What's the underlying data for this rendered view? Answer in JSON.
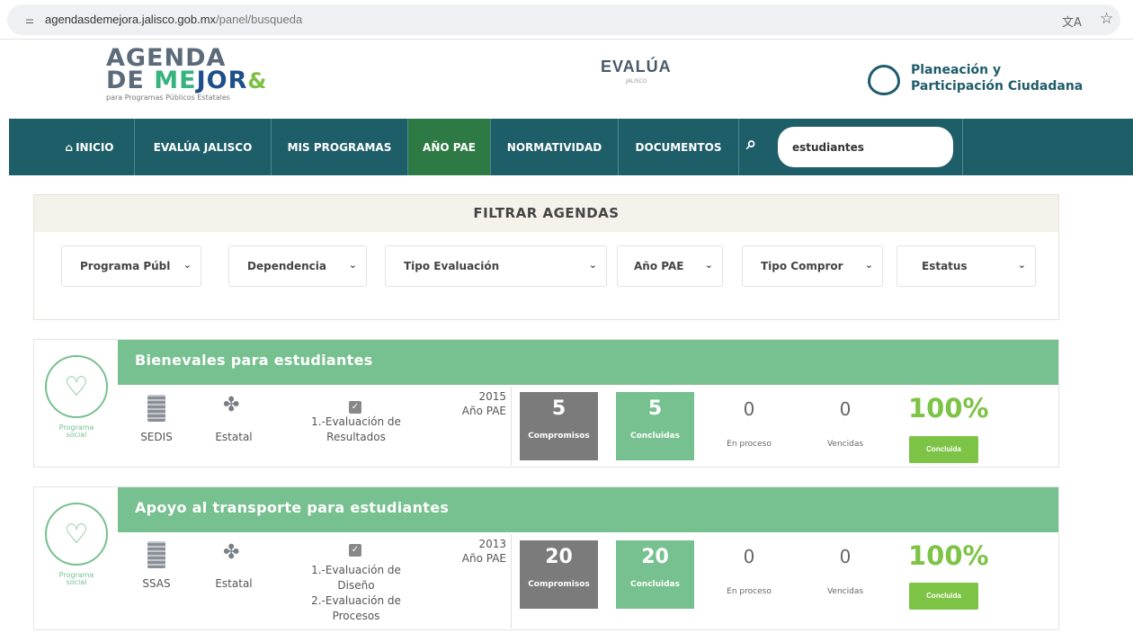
{
  "browser": {
    "url_host": "agendasdemejora.jalisco.gob.mx",
    "url_path": "/panel/busqueda",
    "site_icon": "site-info-icon",
    "translate_icon": "translate-icon",
    "bookmark_icon": "star-icon"
  },
  "header": {
    "logo_line1": "AGENDA",
    "logo_de": "DE ",
    "logo_me": "ME",
    "logo_jor": "JOR",
    "logo_amp": "&",
    "logo_sub": "para Programas Públicos Estatales",
    "evalua": "EVALÚA",
    "evalua_sub": "JALISCO",
    "pp_line1": "Planeación y",
    "pp_line2": "Participación Ciudadana"
  },
  "nav": {
    "inicio": "INICIO",
    "evalua_jalisco": "EVALÚA JALISCO",
    "mis_programas": "MIS PROGRAMAS",
    "ano_pae": "AÑO PAE",
    "normatividad": "NORMATIVIDAD",
    "documentos": "DOCUMENTOS",
    "search_value": "estudiantes"
  },
  "filter": {
    "title": "FILTRAR AGENDAS",
    "programa": "Programa Públ",
    "dependencia": "Dependencia",
    "tipo_evaluacion": "Tipo Evaluación",
    "ano_pae": "Año PAE",
    "tipo_compromiso": "Tipo Compror",
    "estatus": "Estatus"
  },
  "cards": [
    {
      "title": "Bienevales para estudiantes",
      "badge_line1": "Programa",
      "badge_line2": "social",
      "dependencia": "SEDIS",
      "ambito": "Estatal",
      "evaluaciones": [
        "1.-Evaluación de",
        "Resultados"
      ],
      "year": "2015",
      "year_label": "Año PAE",
      "compromisos": "5",
      "compromisos_label": "Compromisos",
      "concluidas": "5",
      "concluidas_label": "Concluidas",
      "en_proceso": "0",
      "en_proceso_label": "En proceso",
      "vencidas": "0",
      "vencidas_label": "Vencidas",
      "percent": "100%",
      "status": "Concluida"
    },
    {
      "title": "Apoyo al transporte para estudiantes",
      "badge_line1": "Programa",
      "badge_line2": "social",
      "dependencia": "SSAS",
      "ambito": "Estatal",
      "evaluaciones": [
        "1.-Evaluación de",
        "Diseño",
        "2.-Evaluación de",
        "Procesos"
      ],
      "year": "2013",
      "year_label": "Año PAE",
      "compromisos": "20",
      "compromisos_label": "Compromisos",
      "concluidas": "20",
      "concluidas_label": "Concluidas",
      "en_proceso": "0",
      "en_proceso_label": "En proceso",
      "vencidas": "0",
      "vencidas_label": "Vencidas",
      "percent": "100%",
      "status": "Concluida"
    }
  ],
  "colors": {
    "nav": "#1e5e68",
    "nav_active": "#2e7a45",
    "card_band": "#77c08f",
    "percent": "#7dc346"
  }
}
